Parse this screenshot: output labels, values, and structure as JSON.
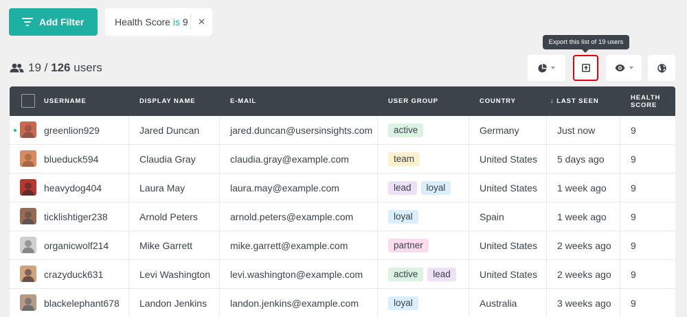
{
  "toolbar": {
    "add_filter_label": "Add Filter",
    "filter": {
      "field": "Health Score",
      "operator": "is",
      "value": "9",
      "close": "×"
    },
    "tooltip": "Export this list of 19 users"
  },
  "summary": {
    "filtered": "19",
    "slash": "/",
    "total": "126",
    "unit": "users"
  },
  "columns": [
    "USERNAME",
    "DISPLAY NAME",
    "E-MAIL",
    "USER GROUP",
    "COUNTRY",
    "↓ LAST SEEN",
    "HEALTH SCORE"
  ],
  "rows": [
    {
      "username": "greenlion929",
      "display": "Jared Duncan",
      "email": "jared.duncan@usersinsights.com",
      "groups": [
        "active"
      ],
      "country": "Germany",
      "last_seen": "Just now",
      "score": "9",
      "online": true
    },
    {
      "username": "blueduck594",
      "display": "Claudia Gray",
      "email": "claudia.gray@example.com",
      "groups": [
        "team"
      ],
      "country": "United States",
      "last_seen": "5 days ago",
      "score": "9",
      "online": false
    },
    {
      "username": "heavydog404",
      "display": "Laura May",
      "email": "laura.may@example.com",
      "groups": [
        "lead",
        "loyal"
      ],
      "country": "United States",
      "last_seen": "1 week ago",
      "score": "9",
      "online": false
    },
    {
      "username": "ticklishtiger238",
      "display": "Arnold Peters",
      "email": "arnold.peters@example.com",
      "groups": [
        "loyal"
      ],
      "country": "Spain",
      "last_seen": "1 week ago",
      "score": "9",
      "online": false
    },
    {
      "username": "organicwolf214",
      "display": "Mike Garrett",
      "email": "mike.garrett@example.com",
      "groups": [
        "partner"
      ],
      "country": "United States",
      "last_seen": "2 weeks ago",
      "score": "9",
      "online": false
    },
    {
      "username": "crazyduck631",
      "display": "Levi Washington",
      "email": "levi.washington@example.com",
      "groups": [
        "active",
        "lead"
      ],
      "country": "United States",
      "last_seen": "2 weeks ago",
      "score": "9",
      "online": false
    },
    {
      "username": "blackelephant678",
      "display": "Landon Jenkins",
      "email": "landon.jenkins@example.com",
      "groups": [
        "loyal"
      ],
      "country": "Australia",
      "last_seen": "3 weeks ago",
      "score": "9",
      "online": false
    }
  ],
  "colors": {
    "accent": "#1fb0a4",
    "header": "#3c434a",
    "highlight": "#e3000f"
  }
}
